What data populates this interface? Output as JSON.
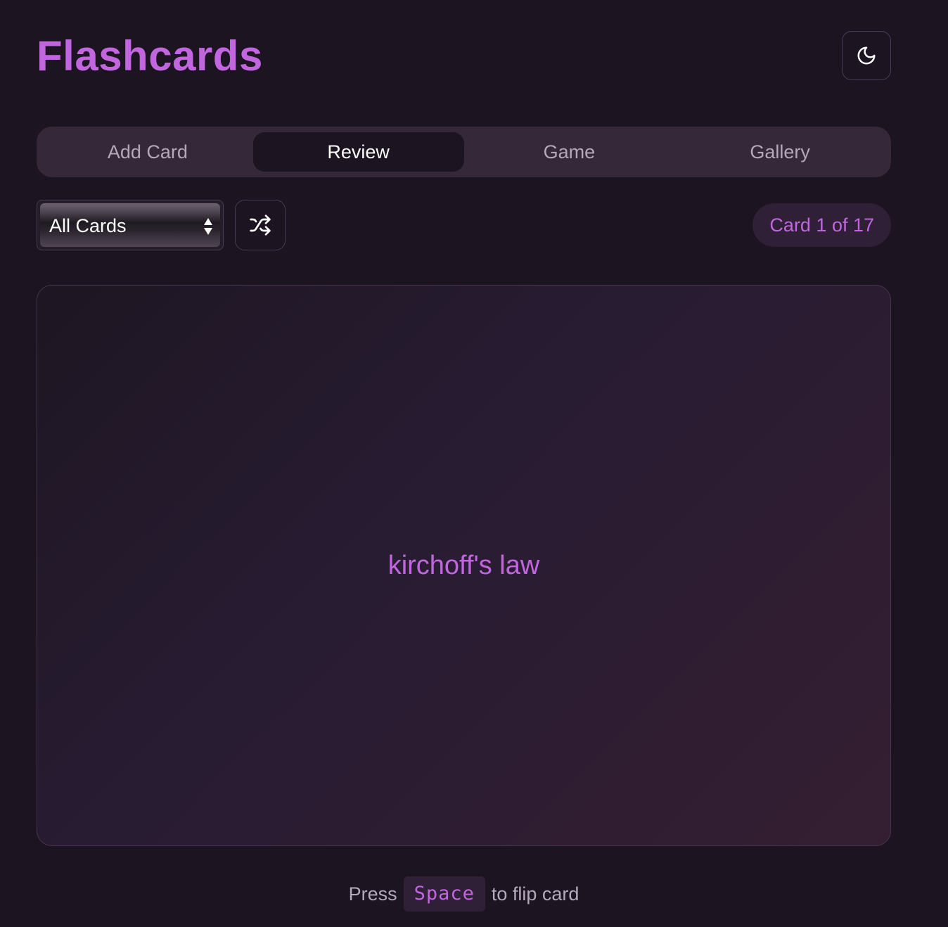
{
  "header": {
    "title": "Flashcards",
    "theme_toggle_icon": "moon-icon"
  },
  "tabs": [
    {
      "label": "Add Card",
      "active": false
    },
    {
      "label": "Review",
      "active": true
    },
    {
      "label": "Game",
      "active": false
    },
    {
      "label": "Gallery",
      "active": false
    }
  ],
  "controls": {
    "filter_value": "All Cards",
    "filter_arrows_icon": "up-down-arrows-icon",
    "shuffle_icon": "shuffle-icon",
    "counter": "Card 1 of 17"
  },
  "card": {
    "front_text": "kirchoff's law"
  },
  "hint": {
    "prefix": "Press",
    "key": "Space",
    "suffix": "to flip card"
  },
  "colors": {
    "background": "#1c1420",
    "accent": "#c266e0",
    "tab_bar": "#352838",
    "muted_text": "#b4a8bb"
  }
}
